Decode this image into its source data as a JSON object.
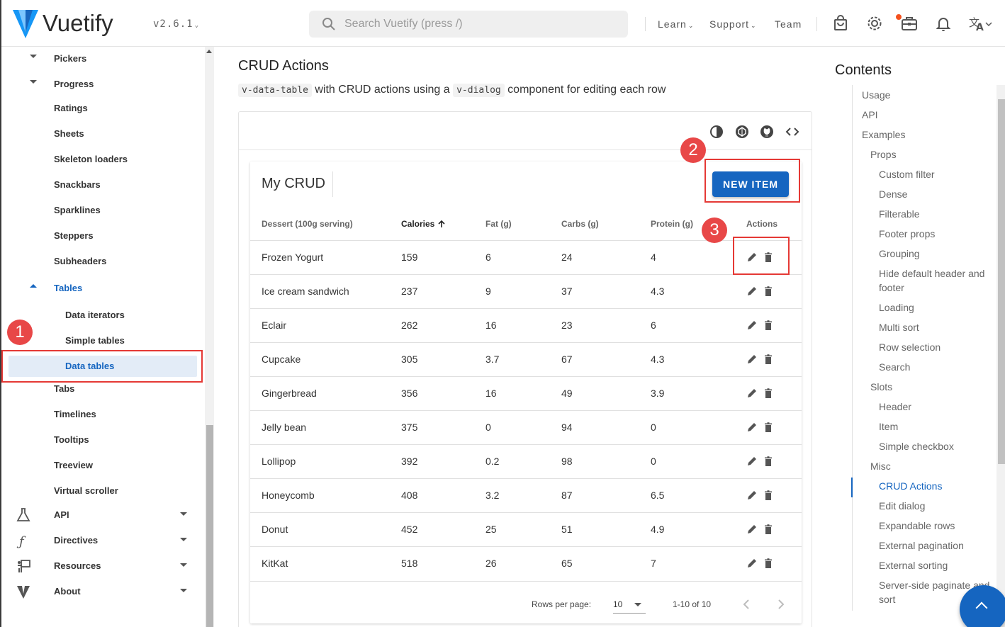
{
  "appbar": {
    "brand": "Vuetify",
    "version": "v2.6.1",
    "search_placeholder": "Search Vuetify (press /)",
    "nav": [
      "Learn",
      "Support",
      "Team"
    ]
  },
  "sidebar": {
    "items": [
      {
        "label": "Pickers"
      },
      {
        "label": "Progress"
      },
      {
        "label": "Ratings"
      },
      {
        "label": "Sheets"
      },
      {
        "label": "Skeleton loaders"
      },
      {
        "label": "Snackbars"
      },
      {
        "label": "Sparklines"
      },
      {
        "label": "Steppers"
      },
      {
        "label": "Subheaders"
      },
      {
        "label": "Tables"
      },
      {
        "label": "Data iterators"
      },
      {
        "label": "Simple tables"
      },
      {
        "label": "Data tables"
      },
      {
        "label": "Tabs"
      },
      {
        "label": "Timelines"
      },
      {
        "label": "Tooltips"
      },
      {
        "label": "Treeview"
      },
      {
        "label": "Virtual scroller"
      },
      {
        "label": "API"
      },
      {
        "label": "Directives"
      },
      {
        "label": "Resources"
      },
      {
        "label": "About"
      }
    ]
  },
  "main": {
    "title": "CRUD Actions",
    "desc_code1": "v-data-table",
    "desc_text1": " with CRUD actions using a ",
    "desc_code2": "v-dialog",
    "desc_text2": " component for editing each row",
    "crud_title": "My CRUD",
    "new_item": "NEW ITEM",
    "headers": [
      "Dessert (100g serving)",
      "Calories",
      "Fat (g)",
      "Carbs (g)",
      "Protein (g)",
      "Actions"
    ],
    "rows": [
      [
        "Frozen Yogurt",
        "159",
        "6",
        "24",
        "4"
      ],
      [
        "Ice cream sandwich",
        "237",
        "9",
        "37",
        "4.3"
      ],
      [
        "Eclair",
        "262",
        "16",
        "23",
        "6"
      ],
      [
        "Cupcake",
        "305",
        "3.7",
        "67",
        "4.3"
      ],
      [
        "Gingerbread",
        "356",
        "16",
        "49",
        "3.9"
      ],
      [
        "Jelly bean",
        "375",
        "0",
        "94",
        "0"
      ],
      [
        "Lollipop",
        "392",
        "0.2",
        "98",
        "0"
      ],
      [
        "Honeycomb",
        "408",
        "3.2",
        "87",
        "6.5"
      ],
      [
        "Donut",
        "452",
        "25",
        "51",
        "4.9"
      ],
      [
        "KitKat",
        "518",
        "26",
        "65",
        "7"
      ]
    ],
    "rows_per_page_label": "Rows per page:",
    "rows_per_page_value": "10",
    "page_range": "1-10 of 10"
  },
  "annotations": [
    "1",
    "2",
    "3"
  ],
  "toc": {
    "title": "Contents",
    "items": [
      {
        "label": "Usage"
      },
      {
        "label": "API"
      },
      {
        "label": "Examples"
      },
      {
        "label": "Props"
      },
      {
        "label": "Custom filter"
      },
      {
        "label": "Dense"
      },
      {
        "label": "Filterable"
      },
      {
        "label": "Footer props"
      },
      {
        "label": "Grouping"
      },
      {
        "label": "Hide default header and footer"
      },
      {
        "label": "Loading"
      },
      {
        "label": "Multi sort"
      },
      {
        "label": "Row selection"
      },
      {
        "label": "Search"
      },
      {
        "label": "Slots"
      },
      {
        "label": "Header"
      },
      {
        "label": "Item"
      },
      {
        "label": "Simple checkbox"
      },
      {
        "label": "Misc"
      },
      {
        "label": "CRUD Actions"
      },
      {
        "label": "Edit dialog"
      },
      {
        "label": "Expandable rows"
      },
      {
        "label": "External pagination"
      },
      {
        "label": "External sorting"
      },
      {
        "label": "Server-side paginate and sort"
      }
    ]
  },
  "colors": {
    "primary": "#1565c0",
    "annotation": "#e53935"
  }
}
